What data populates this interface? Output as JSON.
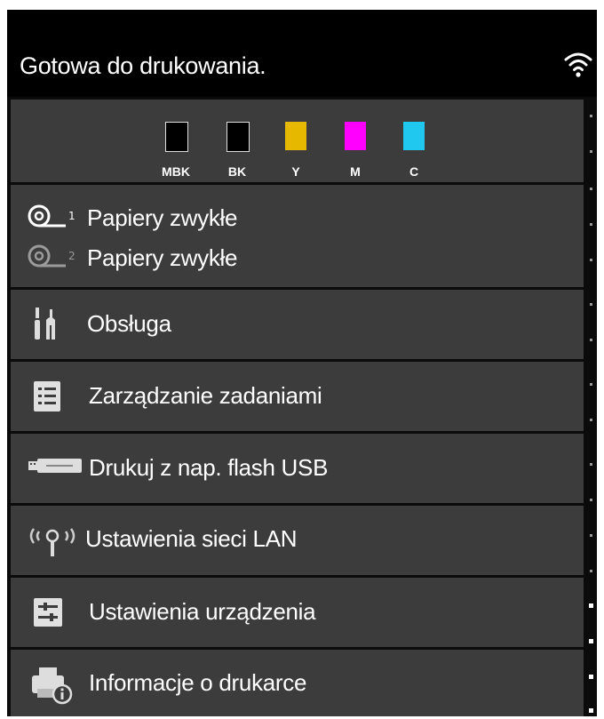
{
  "status": {
    "text": "Gotowa do drukowania.",
    "wifi_icon": "wifi-icon"
  },
  "ink": {
    "cartridges": [
      {
        "label": "MBK",
        "color": "#000000"
      },
      {
        "label": "BK",
        "color": "#000000"
      },
      {
        "label": "Y",
        "color": "#e6b800"
      },
      {
        "label": "M",
        "color": "#ff00ff"
      },
      {
        "label": "C",
        "color": "#20c8f0"
      }
    ]
  },
  "paper": {
    "roll1_label": "Papiery zwykłe",
    "roll2_label": "Papiery zwykłe",
    "roll1_icon": "paper-roll-1-icon",
    "roll2_icon": "paper-roll-2-icon"
  },
  "menu": {
    "items": [
      {
        "label": "Obsługa",
        "icon": "maintenance-icon"
      },
      {
        "label": "Zarządzanie zadaniami",
        "icon": "job-list-icon"
      },
      {
        "label": "Drukuj z nap. flash USB",
        "icon": "usb-flash-icon"
      },
      {
        "label": "Ustawienia sieci LAN",
        "icon": "lan-antenna-icon"
      },
      {
        "label": "Ustawienia urządzenia",
        "icon": "device-settings-icon"
      },
      {
        "label": "Informacje o drukarce",
        "icon": "printer-info-icon"
      }
    ]
  },
  "colors": {
    "background": "#0b0b0b",
    "panel": "#3c3c3c",
    "text": "#ffffff"
  }
}
